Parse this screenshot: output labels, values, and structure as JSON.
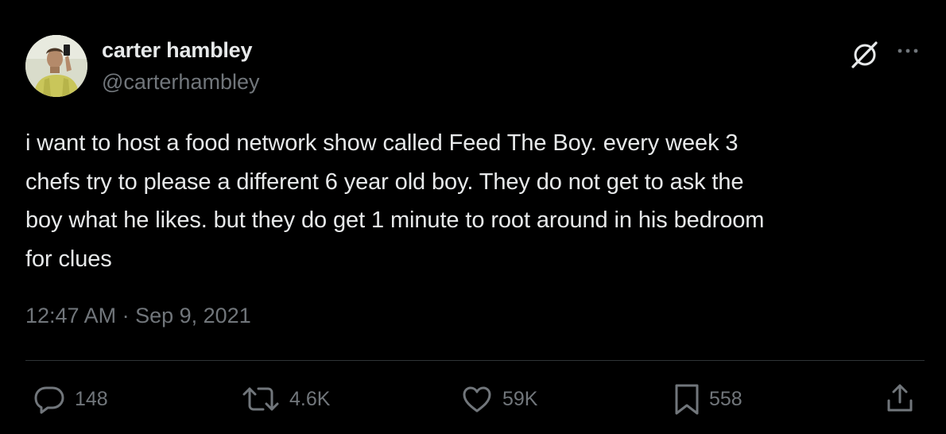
{
  "author": {
    "display_name": "carter hambley",
    "handle": "@carterhambley",
    "avatar_icon": "profile-photo"
  },
  "header_actions": {
    "grok_icon": "grok-icon",
    "more_icon": "more-icon"
  },
  "tweet": {
    "lines": [
      "i want to host a food network show called Feed The Boy. every week 3",
      "chefs try to please a different 6 year old boy. They do not get to ask the",
      "boy what he likes. but they do get 1 minute to root around in his bedroom",
      "for clues"
    ],
    "time": "12:47 AM",
    "separator": " · ",
    "date": "Sep 9, 2021"
  },
  "actions": {
    "reply": {
      "icon": "reply-icon",
      "count": "148"
    },
    "retweet": {
      "icon": "retweet-icon",
      "count": "4.6K"
    },
    "like": {
      "icon": "heart-icon",
      "count": "59K"
    },
    "bookmark": {
      "icon": "bookmark-icon",
      "count": "558"
    },
    "share": {
      "icon": "share-icon"
    }
  },
  "colors": {
    "background": "#000000",
    "primary_text": "#e7e9ea",
    "secondary_text": "#71767b",
    "divider": "#2f3336"
  }
}
